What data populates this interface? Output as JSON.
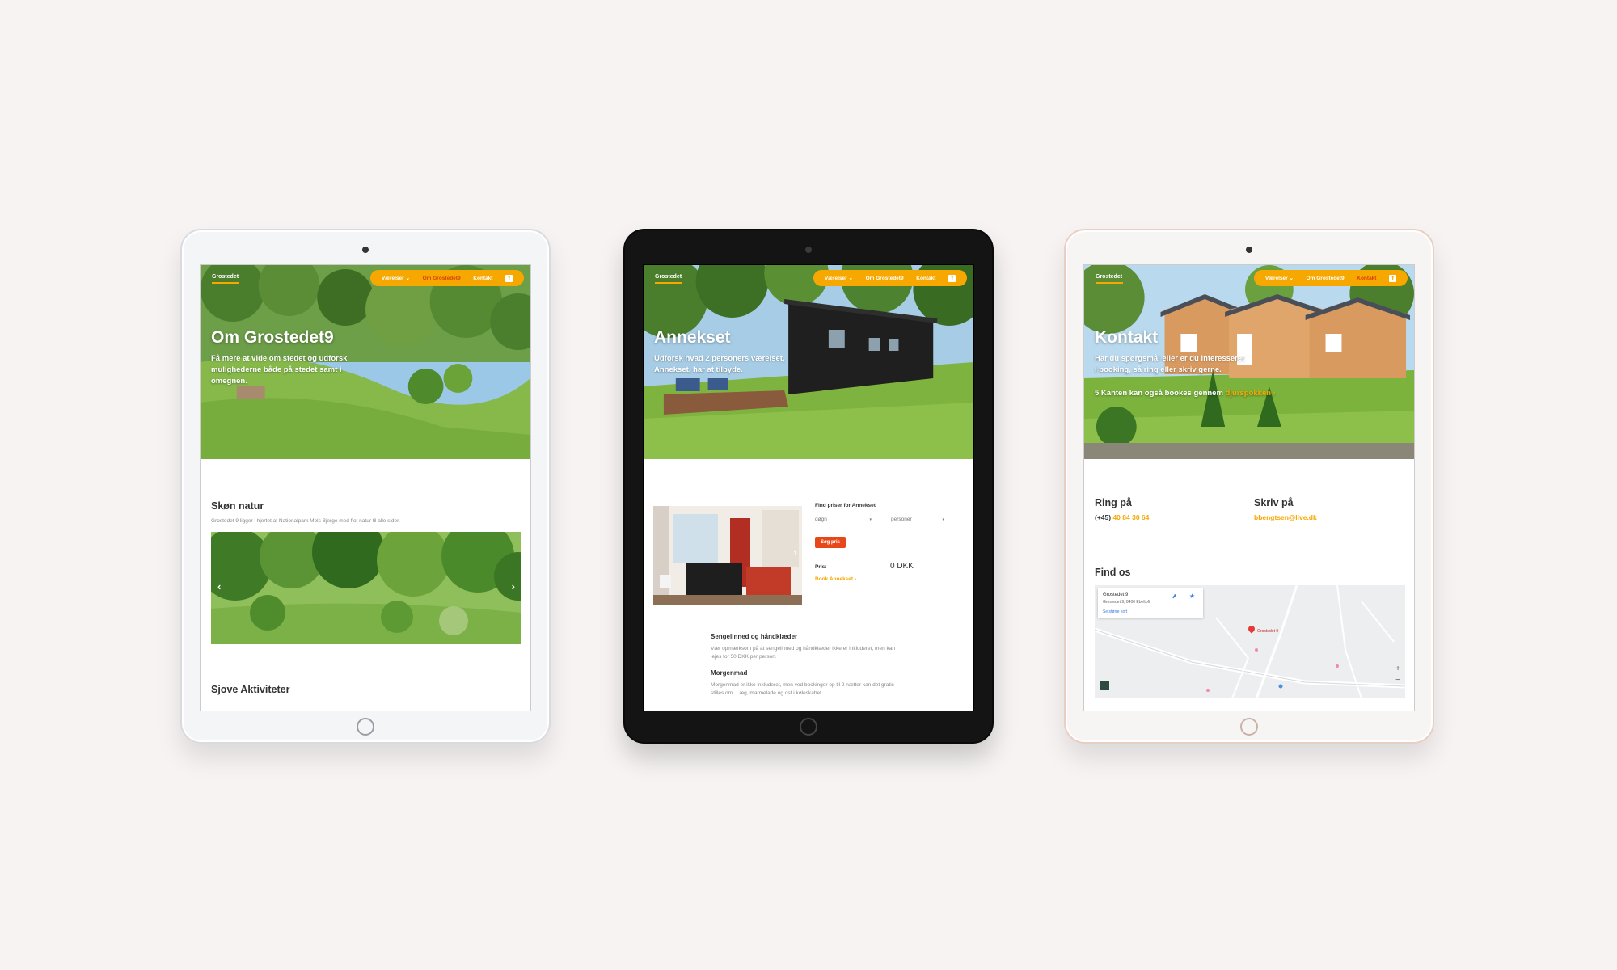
{
  "colors": {
    "accent": "#f7a800",
    "active_nav": "#d7400f",
    "button_red": "#e8471a",
    "text_dark": "#333333"
  },
  "nav": {
    "logo": "Grostedet",
    "items": [
      "Værelser ⌄",
      "Om Grostedet9",
      "Kontakt"
    ],
    "fb_icon": "f"
  },
  "tablets": [
    {
      "frame": "white",
      "active_nav": 1,
      "hero": {
        "title": "Om Grostedet9",
        "text": "Få mere at vide om stedet og udforsk mulighederne både på stedet samt i omegnen."
      },
      "section1": {
        "heading": "Skøn natur",
        "text": "Grostedet 9 ligger i hjertet af Nationalpark Mols Bjerge med flot natur til alle sider."
      },
      "section2": {
        "heading": "Sjove Aktiviteter"
      },
      "gallery_arrows": {
        "prev": "‹",
        "next": "›"
      }
    },
    {
      "frame": "black",
      "active_nav": -1,
      "hero": {
        "title": "Annekset",
        "text": "Udforsk hvad 2 personers værelset, Annekset, har at tilbyde."
      },
      "booking": {
        "heading": "Find priser for Annekset",
        "select_days": "døgn",
        "select_persons": "personer",
        "search_button": "Søg pris",
        "price_label": "Pris:",
        "price_value": "0 DKK",
        "book_link": "Book Annekset ›"
      },
      "info": {
        "h1": "Sengelinned og håndklæder",
        "p1": "Vær opmærksom på at sengelinned og håndklæder ikke er inkluderet, men kan lejes for 50 DKK per person.",
        "h2": "Morgenmad",
        "p2": "Morgenmad er ikke inkluderet, men ved bookinger op til 2 nætter kan det gratis stilles om… æg, marmelade og ost i køleskabet."
      }
    },
    {
      "frame": "gold",
      "active_nav": 2,
      "hero": {
        "title": "Kontakt",
        "text": "Har du spørgsmål eller er du interesseret i booking, så ring eller skriv gerne.",
        "text2_prefix": "5 Kanten kan også bookes gennem ",
        "text2_link": "djurspokken ›"
      },
      "contact": {
        "ring_heading": "Ring på",
        "phone_prefix": "(+45) ",
        "phone": "40 84 30 64",
        "write_heading": "Skriv på",
        "email": "bbengtsen@live.dk",
        "find_heading": "Find os"
      },
      "map": {
        "place_name": "Grostedet 9",
        "address": "Grostedet 9, 8400 Ebeltoft",
        "larger_map": "Se større kort",
        "directions_icon": "directions-icon",
        "save_icon": "star-icon",
        "pin_label": "Grostedet 9",
        "zoom_in": "+",
        "zoom_out": "−"
      }
    }
  ]
}
